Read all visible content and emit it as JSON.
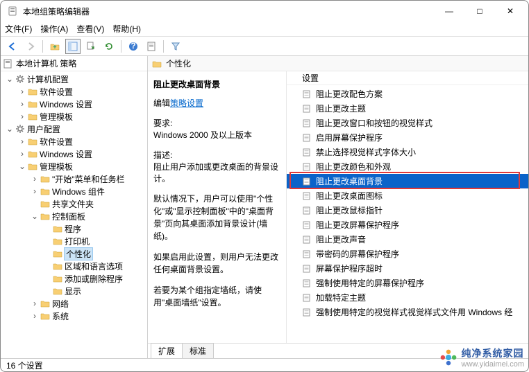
{
  "window": {
    "title": "本地组策略编辑器"
  },
  "winbtns": {
    "min": "—",
    "max": "□",
    "close": "✕"
  },
  "menu": {
    "file": "文件(F)",
    "action": "操作(A)",
    "view": "查看(V)",
    "help": "帮助(H)"
  },
  "tree": {
    "header": "本地计算机 策略",
    "nodes": [
      {
        "indent": 0,
        "chev": "v",
        "ico": "gear",
        "label": "计算机配置"
      },
      {
        "indent": 1,
        "chev": ">",
        "ico": "folder",
        "label": "软件设置"
      },
      {
        "indent": 1,
        "chev": ">",
        "ico": "folder",
        "label": "Windows 设置"
      },
      {
        "indent": 1,
        "chev": ">",
        "ico": "folder",
        "label": "管理模板"
      },
      {
        "indent": 0,
        "chev": "v",
        "ico": "gear",
        "label": "用户配置"
      },
      {
        "indent": 1,
        "chev": ">",
        "ico": "folder",
        "label": "软件设置"
      },
      {
        "indent": 1,
        "chev": ">",
        "ico": "folder",
        "label": "Windows 设置"
      },
      {
        "indent": 1,
        "chev": "v",
        "ico": "folder",
        "label": "管理模板"
      },
      {
        "indent": 2,
        "chev": ">",
        "ico": "folder",
        "label": "\"开始\"菜单和任务栏"
      },
      {
        "indent": 2,
        "chev": ">",
        "ico": "folder",
        "label": "Windows 组件"
      },
      {
        "indent": 2,
        "chev": "",
        "ico": "folder",
        "label": "共享文件夹"
      },
      {
        "indent": 2,
        "chev": "v",
        "ico": "folder",
        "label": "控制面板"
      },
      {
        "indent": 3,
        "chev": "",
        "ico": "folder",
        "label": "程序"
      },
      {
        "indent": 3,
        "chev": "",
        "ico": "folder",
        "label": "打印机"
      },
      {
        "indent": 3,
        "chev": "",
        "ico": "folder",
        "label": "个性化",
        "selected": true
      },
      {
        "indent": 3,
        "chev": "",
        "ico": "folder",
        "label": "区域和语言选项"
      },
      {
        "indent": 3,
        "chev": "",
        "ico": "folder",
        "label": "添加或删除程序"
      },
      {
        "indent": 3,
        "chev": "",
        "ico": "folder",
        "label": "显示"
      },
      {
        "indent": 2,
        "chev": ">",
        "ico": "folder",
        "label": "网络"
      },
      {
        "indent": 2,
        "chev": ">",
        "ico": "folder",
        "label": "系统"
      }
    ]
  },
  "breadcrumb": {
    "label": "个性化"
  },
  "desc": {
    "title": "阻止更改桌面背景",
    "editPrefix": "编辑",
    "editLink": "策略设置",
    "reqLabel": "要求:",
    "reqValue": "Windows 2000 及以上版本",
    "descLabel": "描述:",
    "descValue": "阻止用户添加或更改桌面的背景设计。",
    "p1": "默认情况下，用户可以使用\"个性化\"或\"显示控制面板\"中的\"桌面背景\"页向其桌面添加背景设计(墙纸)。",
    "p2": "如果启用此设置，则用户无法更改任何桌面背景设置。",
    "p3": "若要为某个组指定墙纸，请使用\"桌面墙纸\"设置。"
  },
  "list": {
    "header": "设置",
    "items": [
      "阻止更改配色方案",
      "阻止更改主题",
      "阻止更改窗口和按钮的视觉样式",
      "启用屏幕保护程序",
      "禁止选择视觉样式字体大小",
      "阻止更改颜色和外观",
      "阻止更改桌面背景",
      "阻止更改桌面图标",
      "阻止更改鼠标指针",
      "阻止更改屏幕保护程序",
      "阻止更改声音",
      "带密码的屏幕保护程序",
      "屏幕保护程序超时",
      "强制使用特定的屏幕保护程序",
      "加载特定主题",
      "强制使用特定的视觉样式视觉样式文件用 Windows 经"
    ],
    "selectedIndex": 6
  },
  "tabs": {
    "extended": "扩展",
    "standard": "标准"
  },
  "status": "16 个设置",
  "watermark": {
    "line1": "纯净系统家园",
    "line2": "www.yidaimei.com"
  }
}
